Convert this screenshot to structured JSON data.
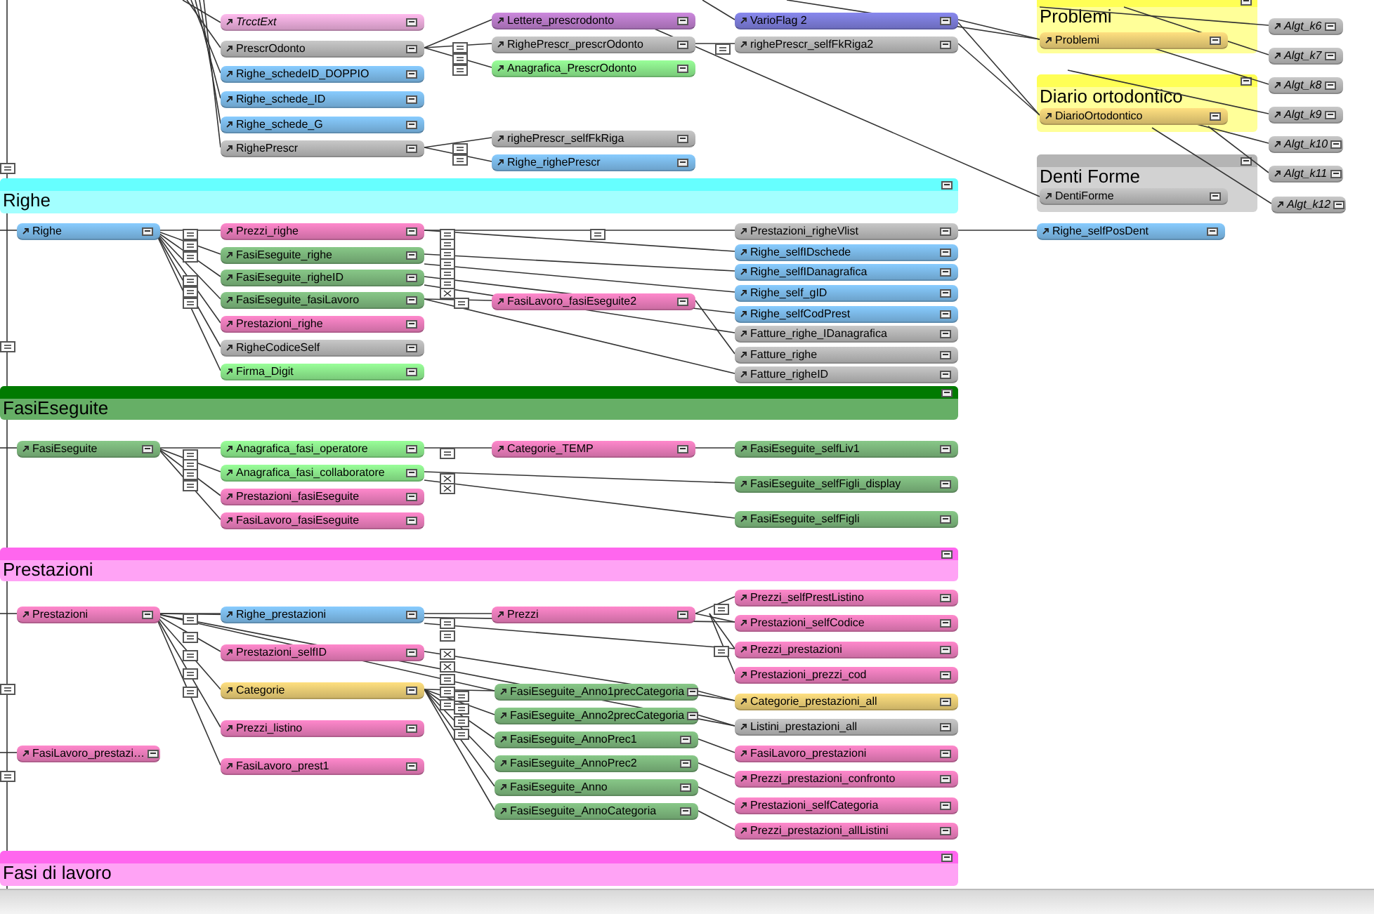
{
  "groups": [
    {
      "title": "Problemi",
      "color": "#ffff55"
    },
    {
      "title": "Diario ortodontico",
      "color": "#ffff55"
    },
    {
      "title": "Denti Forme",
      "color": "#b4b4b4"
    },
    {
      "title": "Righe",
      "color": "#66ffff"
    },
    {
      "title": "FasiEseguite",
      "color": "#007a00"
    },
    {
      "title": "Prestazioni",
      "color": "#ff66ee"
    },
    {
      "title": "Fasi di lavoro",
      "color": "#ff66ee"
    }
  ],
  "tables": [
    {
      "name": "TrcctExt",
      "color": "#ffbbee",
      "external": true
    },
    {
      "name": "Lettere_prescrodonto",
      "color": "#cc88dd",
      "external": false
    },
    {
      "name": "VarioFlag 2",
      "color": "#8888ee",
      "external": false
    },
    {
      "name": "PrescrOdonto",
      "color": "#c8c8c8",
      "external": false
    },
    {
      "name": "RighePrescr_prescrOdonto",
      "color": "#c8c8c8",
      "external": false
    },
    {
      "name": "righePrescr_selfFkRiga2",
      "color": "#c8c8c8",
      "external": false
    },
    {
      "name": "Anagrafica_PrescrOdonto",
      "color": "#99ff99",
      "external": false
    },
    {
      "name": "Righe_schedeID_DOPPIO",
      "color": "#88ccff",
      "external": false
    },
    {
      "name": "Righe_schede_ID",
      "color": "#88ccff",
      "external": false
    },
    {
      "name": "Righe_schede_G",
      "color": "#88ccff",
      "external": false
    },
    {
      "name": "righePrescr_selfFkRiga",
      "color": "#c8c8c8",
      "external": false
    },
    {
      "name": "RighePrescr",
      "color": "#c8c8c8",
      "external": false
    },
    {
      "name": "Righe_righePrescr",
      "color": "#88ccff",
      "external": false
    },
    {
      "name": "Problemi",
      "color": "#ffe080",
      "external": false
    },
    {
      "name": "DiarioOrtodontico",
      "color": "#ffe080",
      "external": false
    },
    {
      "name": "DentiForme",
      "color": "#c8c8c8",
      "external": false
    },
    {
      "name": "Algt_k6",
      "color": "#c8c8c8",
      "external": true
    },
    {
      "name": "Algt_k7",
      "color": "#c8c8c8",
      "external": true
    },
    {
      "name": "Algt_k8",
      "color": "#c8c8c8",
      "external": true
    },
    {
      "name": "Algt_k9",
      "color": "#c8c8c8",
      "external": true
    },
    {
      "name": "Algt_k10",
      "color": "#c8c8c8",
      "external": true
    },
    {
      "name": "Algt_k11",
      "color": "#c8c8c8",
      "external": true
    },
    {
      "name": "Algt_k12",
      "color": "#c8c8c8",
      "external": true
    },
    {
      "name": "Righe",
      "color": "#88ccff",
      "external": false
    },
    {
      "name": "Prezzi_righe",
      "color": "#ff88cc",
      "external": false
    },
    {
      "name": "Prestazioni_righeVlist",
      "color": "#c8c8c8",
      "external": false
    },
    {
      "name": "Righe_selfPosDent",
      "color": "#88ccff",
      "external": false
    },
    {
      "name": "FasiEseguite_righe",
      "color": "#88c888",
      "external": false
    },
    {
      "name": "Righe_selfIDschede",
      "color": "#88ccff",
      "external": false
    },
    {
      "name": "FasiEseguite_righeID",
      "color": "#88c888",
      "external": false
    },
    {
      "name": "Righe_selfIDanagrafica",
      "color": "#88ccff",
      "external": false
    },
    {
      "name": "FasiEseguite_fasiLavoro",
      "color": "#88c888",
      "external": false
    },
    {
      "name": "FasiLavoro_fasiEseguite2",
      "color": "#ff88cc",
      "external": false
    },
    {
      "name": "Righe_self_gID",
      "color": "#88ccff",
      "external": false
    },
    {
      "name": "Righe_selfCodPrest",
      "color": "#88ccff",
      "external": false
    },
    {
      "name": "Prestazioni_righe",
      "color": "#ff88cc",
      "external": false
    },
    {
      "name": "Fatture_righe_IDanagrafica",
      "color": "#c8c8c8",
      "external": false
    },
    {
      "name": "RigheCodiceSelf",
      "color": "#c8c8c8",
      "external": false
    },
    {
      "name": "Fatture_righe",
      "color": "#c8c8c8",
      "external": false
    },
    {
      "name": "Firma_Digit",
      "color": "#99ff99",
      "external": false
    },
    {
      "name": "Fatture_righeID",
      "color": "#c8c8c8",
      "external": false
    },
    {
      "name": "FasiEseguite",
      "color": "#88c888",
      "external": false
    },
    {
      "name": "Anagrafica_fasi_operatore",
      "color": "#99ff99",
      "external": false
    },
    {
      "name": "Categorie_TEMP",
      "color": "#ff88cc",
      "external": false
    },
    {
      "name": "FasiEseguite_selfLiv1",
      "color": "#88c888",
      "external": false
    },
    {
      "name": "Anagrafica_fasi_collaboratore",
      "color": "#99ff99",
      "external": false
    },
    {
      "name": "FasiEseguite_selfFigli_display",
      "color": "#88c888",
      "external": false
    },
    {
      "name": "Prestazioni_fasiEseguite",
      "color": "#ff88cc",
      "external": false
    },
    {
      "name": "FasiLavoro_fasiEseguite",
      "color": "#ff88cc",
      "external": false
    },
    {
      "name": "FasiEseguite_selfFigli",
      "color": "#88c888",
      "external": false
    },
    {
      "name": "Prezzi_selfPrestListino",
      "color": "#ff88cc",
      "external": false
    },
    {
      "name": "Prestazioni",
      "color": "#ff88cc",
      "external": false
    },
    {
      "name": "Righe_prestazioni",
      "color": "#88ccff",
      "external": false
    },
    {
      "name": "Prezzi",
      "color": "#ff88cc",
      "external": false
    },
    {
      "name": "Prestazioni_selfCodice",
      "color": "#ff88cc",
      "external": false
    },
    {
      "name": "Prestazioni_selfID",
      "color": "#ff88cc",
      "external": false
    },
    {
      "name": "Prezzi_prestazioni",
      "color": "#ff88cc",
      "external": false
    },
    {
      "name": "Prestazioni_prezzi_cod",
      "color": "#ff88cc",
      "external": false
    },
    {
      "name": "Categorie",
      "color": "#ffe080",
      "external": false
    },
    {
      "name": "FasiEseguite_Anno1precCategoria",
      "color": "#88c888",
      "external": false
    },
    {
      "name": "Categorie_prestazioni_all",
      "color": "#ffe080",
      "external": false
    },
    {
      "name": "FasiEseguite_Anno2precCategoria",
      "color": "#88c888",
      "external": false
    },
    {
      "name": "Prezzi_listino",
      "color": "#ff88cc",
      "external": false
    },
    {
      "name": "Listini_prestazioni_all",
      "color": "#c8c8c8",
      "external": false
    },
    {
      "name": "FasiEseguite_AnnoPrec1",
      "color": "#88c888",
      "external": false
    },
    {
      "name": "FasiLavoro_prestazi…",
      "color": "#ff88cc",
      "external": false
    },
    {
      "name": "FasiLavoro_prestazioni",
      "color": "#ff88cc",
      "external": false
    },
    {
      "name": "FasiLavoro_prest1",
      "color": "#ff88cc",
      "external": false
    },
    {
      "name": "FasiEseguite_AnnoPrec2",
      "color": "#88c888",
      "external": false
    },
    {
      "name": "Prezzi_prestazioni_confronto",
      "color": "#ff88cc",
      "external": false
    },
    {
      "name": "FasiEseguite_Anno",
      "color": "#88c888",
      "external": false
    },
    {
      "name": "Prestazioni_selfCategoria",
      "color": "#ff88cc",
      "external": false
    },
    {
      "name": "FasiEseguite_AnnoCategoria",
      "color": "#88c888",
      "external": false
    },
    {
      "name": "Prezzi_prestazioni_allListini",
      "color": "#ff88cc",
      "external": false
    }
  ]
}
